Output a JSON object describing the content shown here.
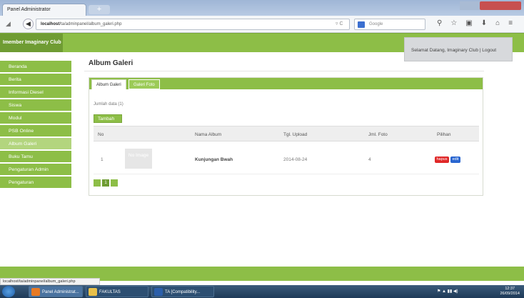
{
  "browser": {
    "tab_title": "Panel Administrator",
    "new_tab": "+",
    "url_host": "localhost",
    "url_path": "/ta/adminpanel/album_galeri.php",
    "search_placeholder": "Google",
    "search_engine": "8"
  },
  "header": {
    "brand": "Imember Imaginary Club",
    "welcome": "Selamat Datang, Imaginary Club | Logout"
  },
  "sidebar": {
    "items": [
      {
        "label": "Beranda"
      },
      {
        "label": "Berita"
      },
      {
        "label": "Informasi Diesel"
      },
      {
        "label": "Siswa"
      },
      {
        "label": "Modul"
      },
      {
        "label": "PSB Online"
      },
      {
        "label": "Album Galeri"
      },
      {
        "label": "Buku Tamu"
      },
      {
        "label": "Pengaturan Admin"
      },
      {
        "label": "Pengaturan"
      }
    ],
    "active_index": 6
  },
  "main": {
    "title": "Album Galeri",
    "tabs": [
      {
        "label": "Album Galeri"
      },
      {
        "label": "Galeri Foto"
      }
    ],
    "count_text": "Jumlah data (1)",
    "add_button": "Tambah",
    "columns": [
      "No",
      "Nama Album",
      "Tgl. Upload",
      "Jml. Foto",
      "Pilihan"
    ],
    "rows": [
      {
        "no": "1",
        "thumb": "No Image",
        "name": "Kunjungan Bwah",
        "date": "2014-08-24",
        "photos": "4",
        "del": "hapus",
        "edit": "edit"
      }
    ],
    "pager": [
      "",
      "1",
      ""
    ]
  },
  "status_url": "localhost/ta/adminpanel/album_galeri.php",
  "taskbar": {
    "tasks": [
      {
        "label": "Panel Administrat..."
      },
      {
        "label": "FAKULTAS"
      },
      {
        "label": "TA [Compatibility..."
      }
    ],
    "time": "12:37",
    "date": "26/09/2014"
  },
  "colors": {
    "green": "#8dbe47",
    "dark_green": "#6f9c33",
    "red": "#e02828",
    "blue": "#2a66d0"
  }
}
